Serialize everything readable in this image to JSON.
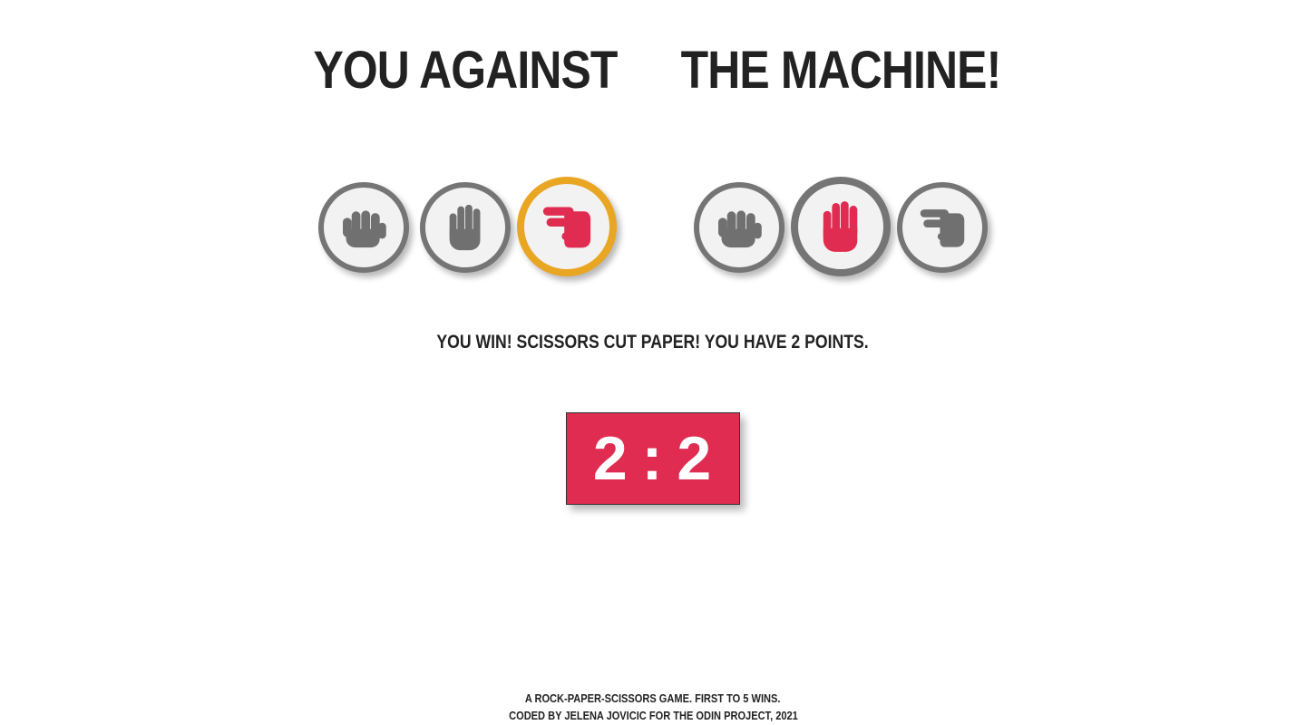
{
  "header": {
    "player_title": "You against",
    "machine_title": "the machine!"
  },
  "player": {
    "choices": [
      {
        "name": "rock",
        "icon": "fist-icon",
        "selected": false
      },
      {
        "name": "paper",
        "icon": "open-hand-icon",
        "selected": false
      },
      {
        "name": "scissors",
        "icon": "two-fingers-icon",
        "selected": true
      }
    ]
  },
  "machine": {
    "choices": [
      {
        "name": "rock",
        "icon": "fist-icon",
        "selected": false
      },
      {
        "name": "paper",
        "icon": "open-hand-icon",
        "selected": true
      },
      {
        "name": "scissors",
        "icon": "two-fingers-icon",
        "selected": false
      }
    ]
  },
  "result": {
    "message": "You win! Scissors cut paper! You have 2 points."
  },
  "score": {
    "player": "2",
    "separator": ":",
    "machine": "2"
  },
  "footer": {
    "line1": "A rock-paper-scissors game. First to 5 wins.",
    "line2": "Coded by Jelena Jovicic for The Odin Project, 2021"
  },
  "colors": {
    "accent_red": "#df2c50",
    "player_selected_ring": "#e9a623",
    "machine_selected_ring": "#757575",
    "icon_grey": "#707070",
    "button_face": "#f2f2f2"
  }
}
